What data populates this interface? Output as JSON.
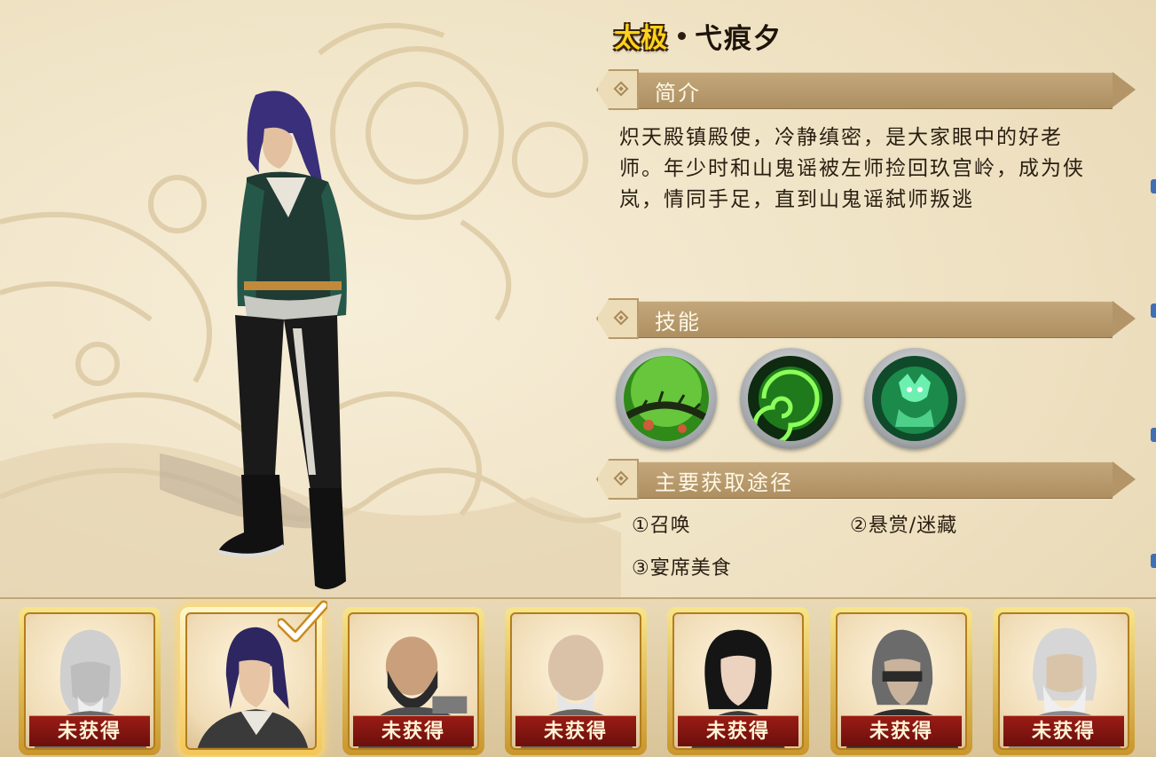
{
  "header": {
    "sect": "太极",
    "name": "弋痕夕"
  },
  "intro": {
    "title": "简介",
    "text": "炽天殿镇殿使，冷静缜密，是大家眼中的好老师。年少时和山鬼谣被左师捡回玖宫岭，成为侠岚，情同手足，直到山鬼谣弑师叛逃"
  },
  "skills": {
    "title": "技能",
    "items": [
      {
        "icon": "thorn-vine-skill-icon"
      },
      {
        "icon": "green-vortex-skill-icon"
      },
      {
        "icon": "jade-dragon-skill-icon"
      }
    ]
  },
  "sources": {
    "title": "主要获取途径",
    "items": [
      "①召唤",
      "②悬赏/迷藏",
      "③宴席美食"
    ]
  },
  "roster": [
    {
      "label": "未获得",
      "selected": false,
      "portrait": "white-haired-elder"
    },
    {
      "label": "",
      "selected": true,
      "portrait": "blue-haired-swordsman"
    },
    {
      "label": "未获得",
      "selected": false,
      "portrait": "bearded-warrior"
    },
    {
      "label": "未获得",
      "selected": false,
      "portrait": "bald-elder"
    },
    {
      "label": "未获得",
      "selected": false,
      "portrait": "dark-haired-girl"
    },
    {
      "label": "未获得",
      "selected": false,
      "portrait": "masked-youth"
    },
    {
      "label": "未获得",
      "selected": false,
      "portrait": "white-bearded-master"
    }
  ],
  "colors": {
    "badge": "#ffd21c",
    "banner": "#b39568",
    "label_red": "#8a1a14",
    "frame_gold": "#e0b54a"
  }
}
